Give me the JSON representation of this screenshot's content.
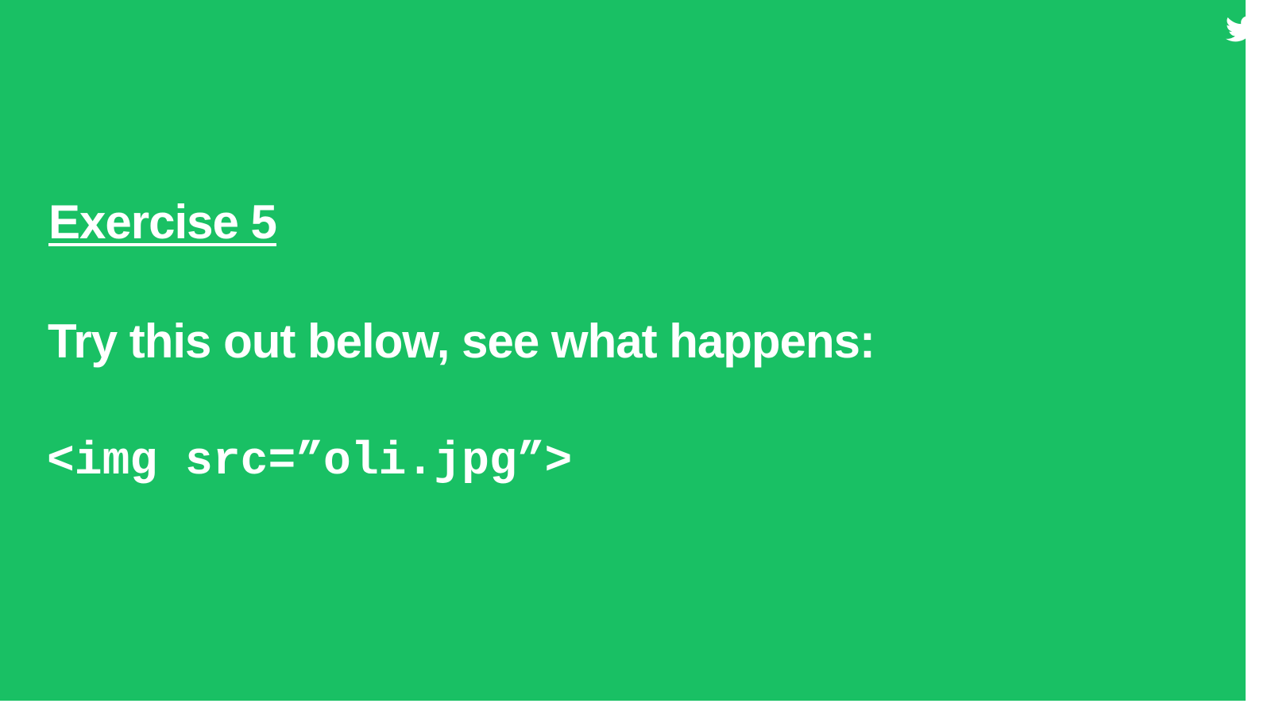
{
  "slide": {
    "background_color": "#19c064",
    "text_color": "#ffffff",
    "corner_icon": "twitter-bird-icon",
    "heading": "Exercise 5",
    "instruction": "Try this out below, see what happens:",
    "code": "<img src=”oli.jpg”>"
  }
}
